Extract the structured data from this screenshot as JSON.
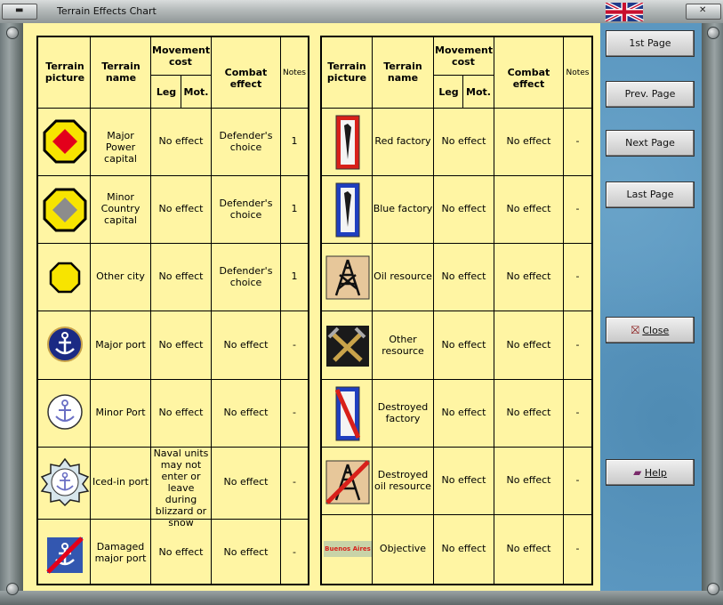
{
  "window": {
    "title": "Terrain Effects Chart"
  },
  "headers": {
    "picture": "Terrain picture",
    "name": "Terrain name",
    "movement": "Movement cost",
    "leg": "Leg",
    "mot": "Mot.",
    "combat": "Combat effect",
    "notes": "Notes"
  },
  "left_rows": [
    {
      "name": "Major Power capital",
      "move": "No effect",
      "combat": "Defender's choice",
      "notes": "1"
    },
    {
      "name": "Minor Country capital",
      "move": "No effect",
      "combat": "Defender's choice",
      "notes": "1"
    },
    {
      "name": "Other city",
      "move": "No effect",
      "combat": "Defender's choice",
      "notes": "1"
    },
    {
      "name": "Major port",
      "move": "No effect",
      "combat": "No effect",
      "notes": "-"
    },
    {
      "name": "Minor Port",
      "move": "No effect",
      "combat": "No effect",
      "notes": "-"
    },
    {
      "name": "Iced-in port",
      "move": "Naval units may not enter or leave during blizzard or snow",
      "combat": "No effect",
      "notes": "-"
    },
    {
      "name": "Damaged major port",
      "move": "No effect",
      "combat": "No effect",
      "notes": "-"
    }
  ],
  "right_rows": [
    {
      "name": "Red factory",
      "move": "No effect",
      "combat": "No effect",
      "notes": "-"
    },
    {
      "name": "Blue factory",
      "move": "No effect",
      "combat": "No effect",
      "notes": "-"
    },
    {
      "name": "Oil resource",
      "move": "No effect",
      "combat": "No effect",
      "notes": "-"
    },
    {
      "name": "Other resource",
      "move": "No effect",
      "combat": "No effect",
      "notes": "-"
    },
    {
      "name": "Destroyed factory",
      "move": "No effect",
      "combat": "No effect",
      "notes": "-"
    },
    {
      "name": "Destroyed oil resource",
      "move": "No effect",
      "combat": "No effect",
      "notes": "-"
    },
    {
      "name": "Objective",
      "move": "No effect",
      "combat": "No effect",
      "notes": "-"
    }
  ],
  "objective_label": "Buenos Aires",
  "buttons": {
    "first": "1st Page",
    "prev": "Prev. Page",
    "next": "Next Page",
    "last": "Last Page",
    "close": "Close",
    "help": "Help"
  },
  "icons": [
    "major-capital-icon",
    "minor-capital-icon",
    "city-icon",
    "major-port-icon",
    "minor-port-icon",
    "iced-port-icon",
    "damaged-port-icon",
    "red-factory-icon",
    "blue-factory-icon",
    "oil-icon",
    "resource-icon",
    "destroyed-factory-icon",
    "destroyed-oil-icon",
    "objective-icon",
    "uk-flag-icon",
    "close-icon",
    "help-icon"
  ]
}
